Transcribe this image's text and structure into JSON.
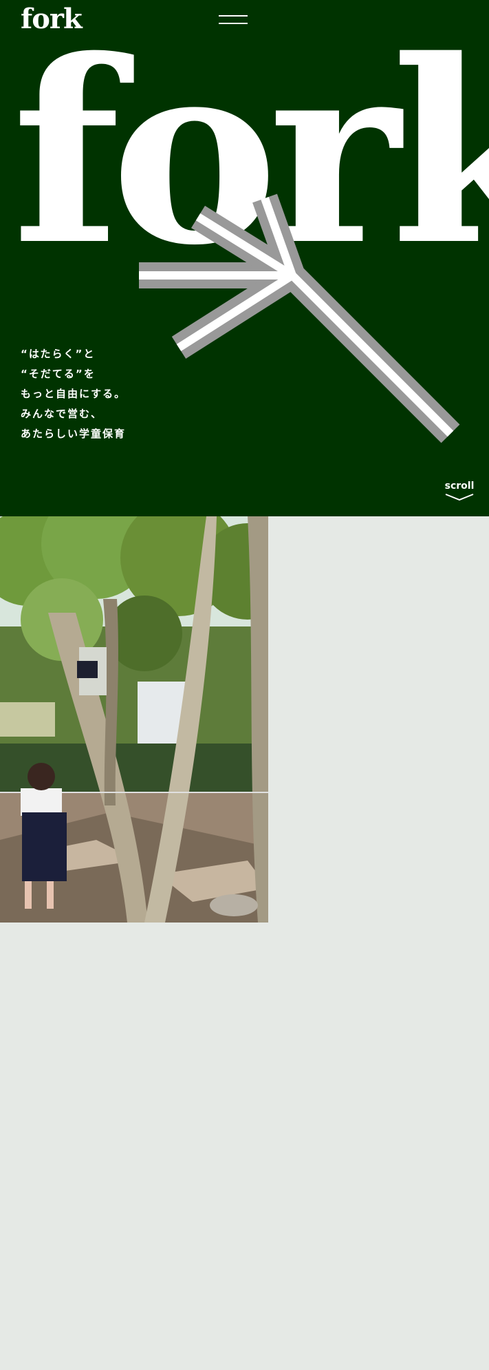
{
  "header": {
    "logo_text": "fork",
    "menu_icon": "hamburger-menu-icon"
  },
  "hero": {
    "big_word": "fork",
    "tagline": [
      "“はたらく”と",
      "“そだてる”を",
      "もっと自由にする。",
      "みんなで営む、",
      "あたらしい学童保育"
    ],
    "scroll_label": "scroll",
    "scroll_icon": "chevron-down-icon"
  },
  "colors": {
    "hero_background": "#003300",
    "page_background": "#e5e9e5",
    "fork_gray": "#999999",
    "text": "#ffffff"
  }
}
